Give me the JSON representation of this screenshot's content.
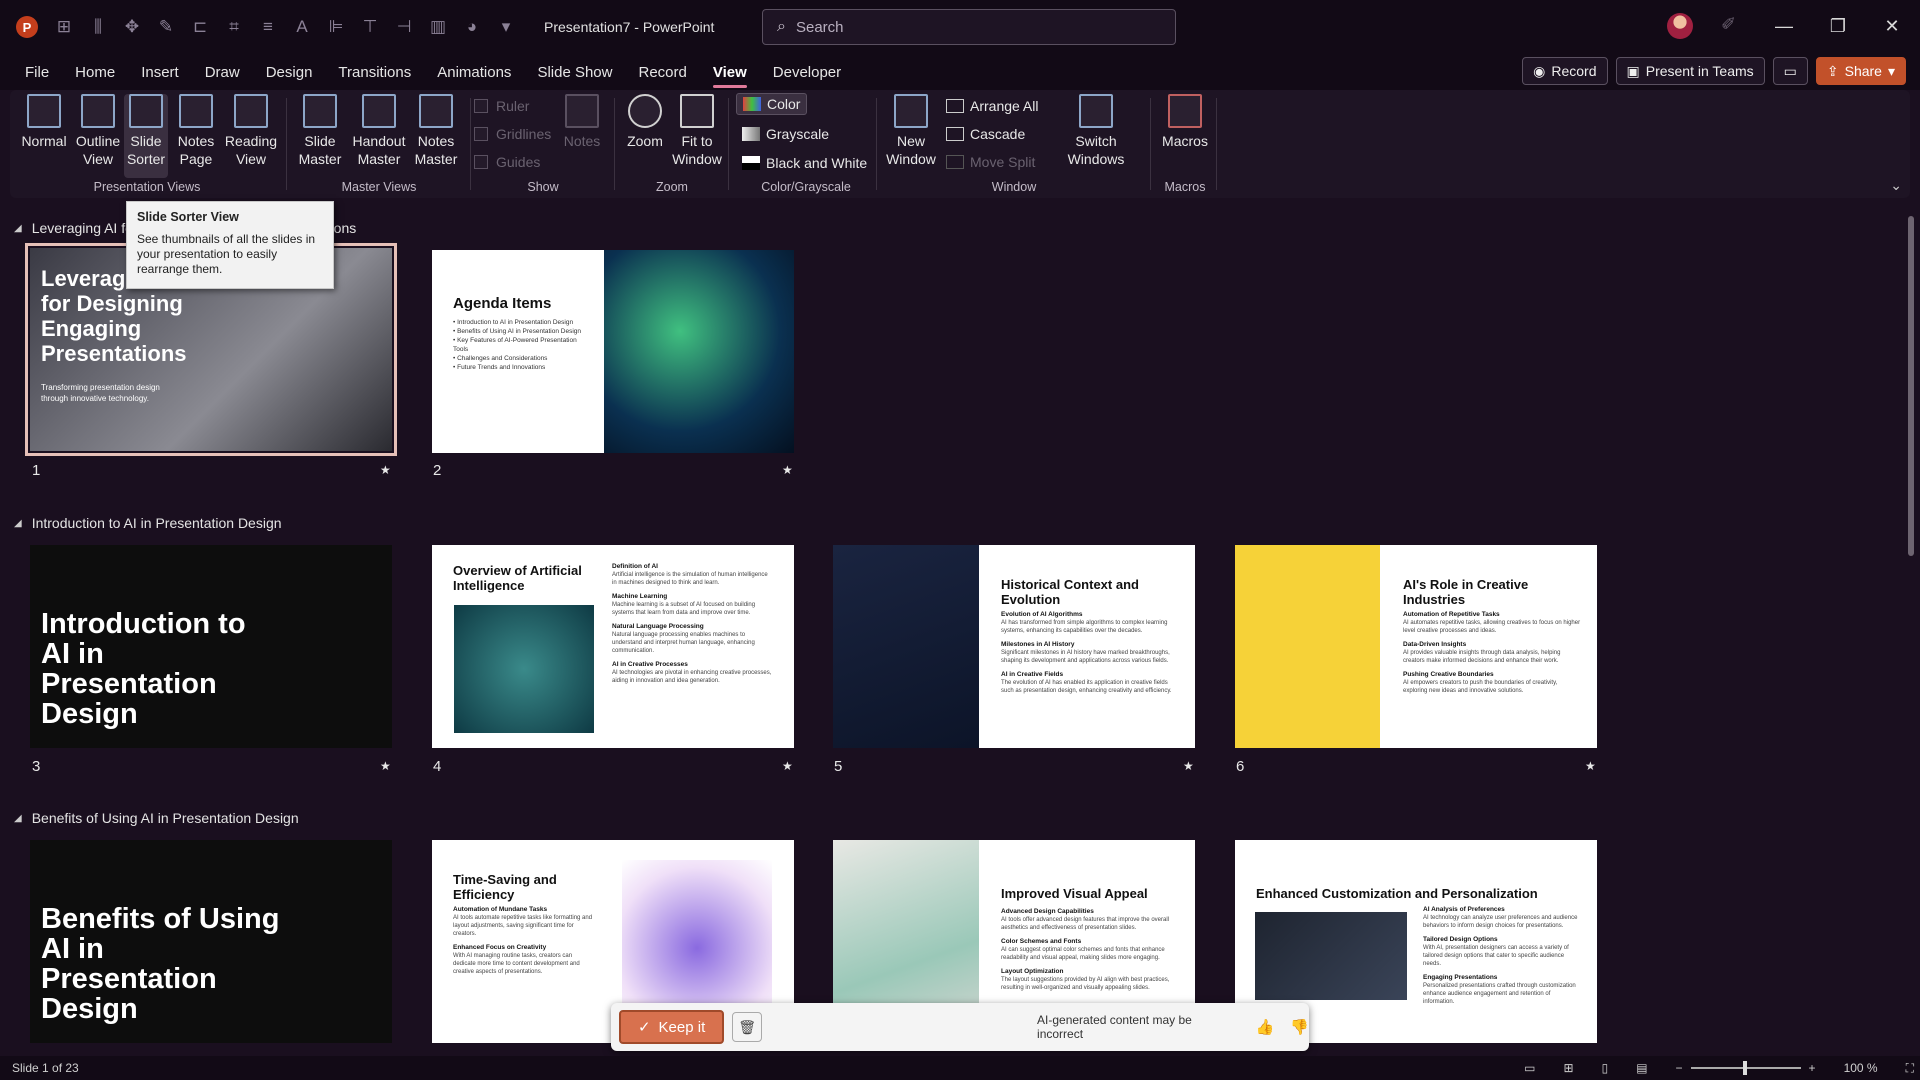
{
  "window": {
    "title": "Presentation7  -  PowerPoint",
    "search_placeholder": "Search",
    "logo": "P"
  },
  "tabs": [
    "File",
    "Home",
    "Insert",
    "Draw",
    "Design",
    "Transitions",
    "Animations",
    "Slide Show",
    "Record",
    "View",
    "Developer"
  ],
  "active_tab": "View",
  "tab_actions": {
    "record": "Record",
    "present_in_teams": "Present in Teams",
    "share": "Share"
  },
  "ribbon": {
    "presentation_views": {
      "label": "Presentation Views",
      "normal": "Normal",
      "outline_1": "Outline",
      "outline_2": "View",
      "sorter_1": "Slide",
      "sorter_2": "Sorter",
      "notes_1": "Notes",
      "notes_2": "Page",
      "reading_1": "Reading",
      "reading_2": "View"
    },
    "master_views": {
      "label": "Master Views",
      "slide_1": "Slide",
      "slide_2": "Master",
      "handout_1": "Handout",
      "handout_2": "Master",
      "notes_1": "Notes",
      "notes_2": "Master"
    },
    "show": {
      "label": "Show",
      "ruler": "Ruler",
      "gridlines": "Gridlines",
      "guides": "Guides",
      "notes": "Notes"
    },
    "zoom": {
      "label": "Zoom",
      "zoom": "Zoom",
      "fit_1": "Fit to",
      "fit_2": "Window"
    },
    "color": {
      "label": "Color/Grayscale",
      "color": "Color",
      "grayscale": "Grayscale",
      "bw": "Black and White"
    },
    "window": {
      "label": "Window",
      "new_1": "New",
      "new_2": "Window",
      "arrange_all": "Arrange All",
      "cascade": "Cascade",
      "move_split": "Move Split",
      "switch_1": "Switch",
      "switch_2": "Windows"
    },
    "macros": {
      "label": "Macros",
      "macros": "Macros"
    }
  },
  "tooltip": {
    "title": "Slide Sorter View",
    "body": "See thumbnails of all the slides in your presentation to easily rearrange them."
  },
  "sections": [
    {
      "title": "Leveraging AI for Designing Engaging Presentations"
    },
    {
      "title": "Introduction to AI in Presentation Design"
    },
    {
      "title": "Benefits of Using AI in Presentation Design"
    }
  ],
  "slides": [
    {
      "num": "1",
      "title": "Leveraging AI for Designing Engaging Presentations",
      "title_visible": "Leverag\nfor Designing\nEngaging\nPresentations",
      "subtitle": "Transforming presentation design through innovative technology."
    },
    {
      "num": "2",
      "title": "Agenda Items",
      "items": [
        "Introduction to AI in Presentation Design",
        "Benefits of Using AI in Presentation Design",
        "Key Features of AI-Powered Presentation Tools",
        "Challenges and Considerations",
        "Future Trends and Innovations"
      ]
    },
    {
      "num": "3",
      "title": "Introduction to AI in Presentation Design"
    },
    {
      "num": "4",
      "title": "Overview of Artificial Intelligence",
      "points": [
        {
          "h": "Definition of AI",
          "t": "Artificial intelligence is the simulation of human intelligence in machines designed to think and learn."
        },
        {
          "h": "Machine Learning",
          "t": "Machine learning is a subset of AI focused on building systems that learn from data and improve over time."
        },
        {
          "h": "Natural Language Processing",
          "t": "Natural language processing enables machines to understand and interpret human language, enhancing communication."
        },
        {
          "h": "AI in Creative Processes",
          "t": "AI technologies are pivotal in enhancing creative processes, aiding in innovation and idea generation."
        }
      ]
    },
    {
      "num": "5",
      "title": "Historical Context and Evolution",
      "points": [
        {
          "h": "Evolution of AI Algorithms",
          "t": "AI has transformed from simple algorithms to complex learning systems, enhancing its capabilities over the decades."
        },
        {
          "h": "Milestones in AI History",
          "t": "Significant milestones in AI history have marked breakthroughs, shaping its development and applications across various fields."
        },
        {
          "h": "AI in Creative Fields",
          "t": "The evolution of AI has enabled its application in creative fields such as presentation design, enhancing creativity and efficiency."
        }
      ]
    },
    {
      "num": "6",
      "title": "AI's Role in Creative Industries",
      "points": [
        {
          "h": "Automation of Repetitive Tasks",
          "t": "AI automates repetitive tasks, allowing creatives to focus on higher level creative processes and ideas."
        },
        {
          "h": "Data-Driven Insights",
          "t": "AI provides valuable insights through data analysis, helping creators make informed decisions and enhance their work."
        },
        {
          "h": "Pushing Creative Boundaries",
          "t": "AI empowers creators to push the boundaries of creativity, exploring new ideas and innovative solutions."
        }
      ]
    },
    {
      "num": "7",
      "title": "Benefits of Using AI in Presentation Design"
    },
    {
      "num": "8",
      "title": "Time-Saving and Efficiency",
      "points": [
        {
          "h": "Automation of Mundane Tasks",
          "t": "AI tools automate repetitive tasks like formatting and layout adjustments, saving significant time for creators."
        },
        {
          "h": "Enhanced Focus on Creativity",
          "t": "With AI managing routine tasks, creators can dedicate more time to content development and creative aspects of presentations."
        }
      ]
    },
    {
      "num": "9",
      "title": "Improved Visual Appeal",
      "points": [
        {
          "h": "Advanced Design Capabilities",
          "t": "AI tools offer advanced design features that improve the overall aesthetics and effectiveness of presentation slides."
        },
        {
          "h": "Color Schemes and Fonts",
          "t": "AI can suggest optimal color schemes and fonts that enhance readability and visual appeal, making slides more engaging."
        },
        {
          "h": "Layout Optimization",
          "t": "The layout suggestions provided by AI align with best practices, resulting in well-organized and visually appealing slides."
        }
      ]
    },
    {
      "num": "10",
      "title": "Enhanced Customization and Personalization",
      "points": [
        {
          "h": "AI Analysis of Preferences",
          "t": "AI technology can analyze user preferences and audience behaviors to inform design choices for presentations."
        },
        {
          "h": "Tailored Design Options",
          "t": "With AI, presentation designers can access a variety of tailored design options that cater to specific audience needs."
        },
        {
          "h": "Engaging Presentations",
          "t": "Personalized presentations crafted through customization enhance audience engagement and retention of information."
        }
      ]
    }
  ],
  "toast": {
    "keep": "Keep it",
    "notice": "AI-generated content may be incorrect"
  },
  "status": {
    "slide_of": "Slide 1 of 23",
    "zoom": "100 %"
  },
  "colors": {
    "accent": "#c2512a",
    "background": "#1a0f1f",
    "ribbon": "#1e1424"
  }
}
